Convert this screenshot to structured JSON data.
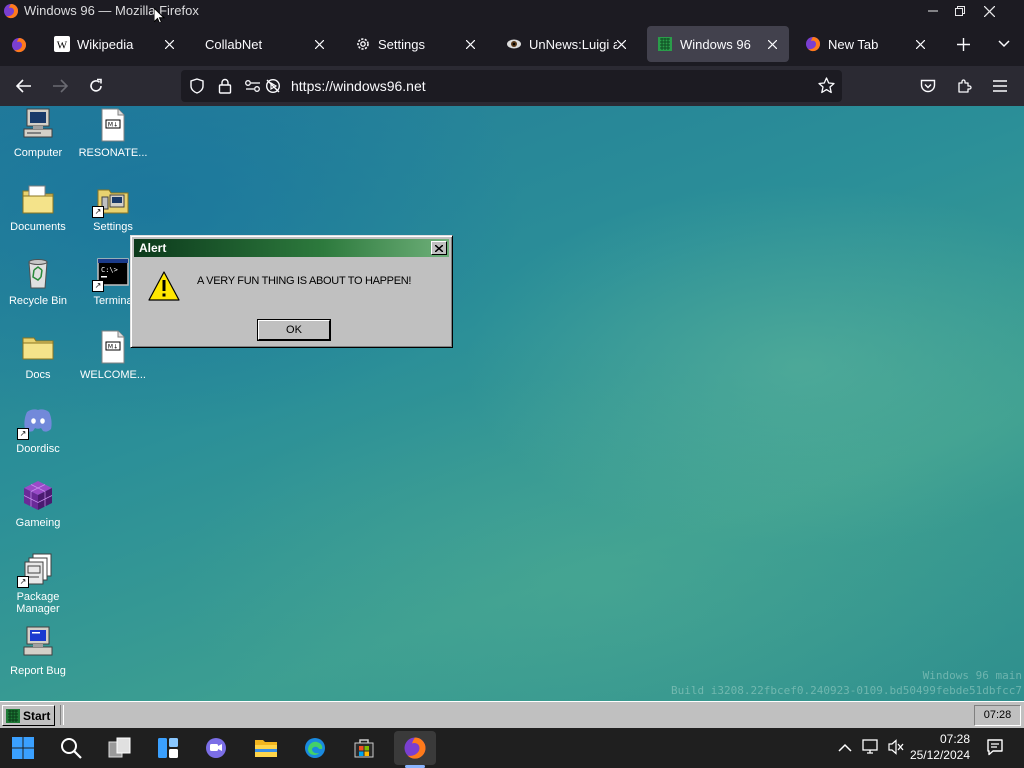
{
  "browser": {
    "window_title": "Windows 96 — Mozilla Firefox",
    "url": "https://windows96.net",
    "tabs": [
      {
        "label": "Wikipedia",
        "icon": "wikipedia-icon"
      },
      {
        "label": "CollabNet",
        "icon": "blank-page-icon"
      },
      {
        "label": "Settings",
        "icon": "gear-icon"
      },
      {
        "label": "UnNews:Luigi ap",
        "icon": "eye-icon"
      },
      {
        "label": "Windows 96",
        "icon": "windows96-icon",
        "active": true
      },
      {
        "label": "New Tab",
        "icon": "firefox-icon"
      }
    ]
  },
  "desktop": {
    "icons": [
      {
        "label": "Computer"
      },
      {
        "label": "RESONATE..."
      },
      {
        "label": "Documents"
      },
      {
        "label": "Settings"
      },
      {
        "label": "Recycle Bin"
      },
      {
        "label": "Termina"
      },
      {
        "label": "Docs"
      },
      {
        "label": "WELCOME..."
      },
      {
        "label": "Doordisc"
      },
      {
        "label": "Gameing"
      },
      {
        "label": "Package Manager"
      },
      {
        "label": "Report Bug"
      }
    ],
    "watermark_line1": "Windows 96 main",
    "watermark_line2": "Build i3208.22fbcef0.240923-0109.bd50499febde51dbfcc7"
  },
  "alert": {
    "title": "Alert",
    "message": "A VERY FUN THING IS ABOUT TO HAPPEN!",
    "ok_label": "OK"
  },
  "w96_taskbar": {
    "start_label": "Start",
    "clock": "07:28"
  },
  "windows_taskbar": {
    "time": "07:28",
    "date": "25/12/2024"
  },
  "colors": {
    "accent_caption": "#0c3a1c",
    "desktop_teal": "#2b8f98",
    "firefox_dark": "#1c1b22"
  }
}
